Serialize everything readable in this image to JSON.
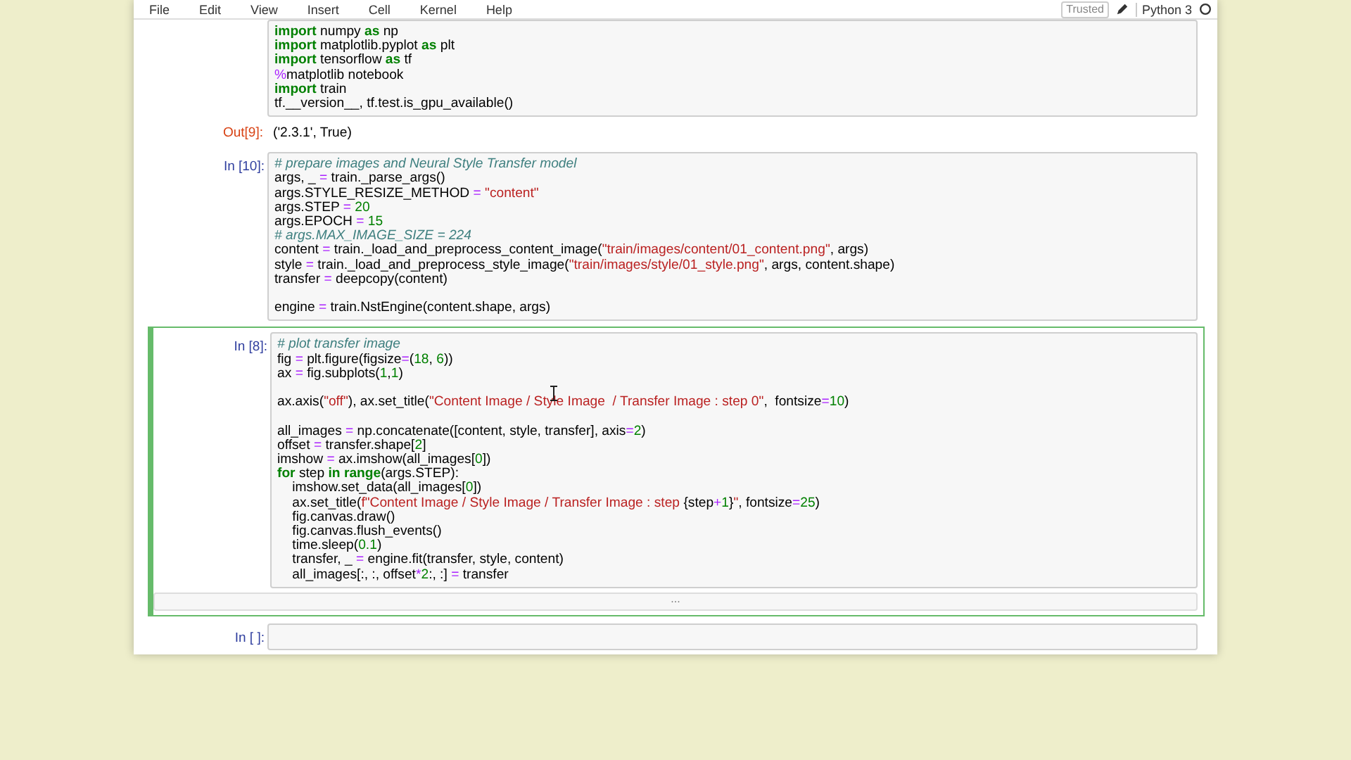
{
  "menu": [
    "File",
    "Edit",
    "View",
    "Insert",
    "Cell",
    "Kernel",
    "Help"
  ],
  "indicators": {
    "trusted": "Trusted",
    "kernel": "Python 3"
  },
  "cells": [
    {
      "kind": "code",
      "selected": false,
      "lines": [
        {
          "kind": "code",
          "tokens": [
            {
              "kind": "keyword",
              "text": "import"
            },
            {
              "kind": "plain",
              "text": " numpy "
            },
            {
              "kind": "keyword",
              "text": "as"
            },
            {
              "kind": "plain",
              "text": " np"
            }
          ]
        },
        {
          "kind": "code",
          "tokens": [
            {
              "kind": "keyword",
              "text": "import"
            },
            {
              "kind": "plain",
              "text": " matplotlib.pyplot "
            },
            {
              "kind": "keyword",
              "text": "as"
            },
            {
              "kind": "plain",
              "text": " plt"
            }
          ]
        },
        {
          "kind": "code",
          "tokens": [
            {
              "kind": "keyword",
              "text": "import"
            },
            {
              "kind": "plain",
              "text": " tensorflow "
            },
            {
              "kind": "keyword",
              "text": "as"
            },
            {
              "kind": "plain",
              "text": " tf"
            }
          ]
        },
        {
          "kind": "code",
          "tokens": [
            {
              "kind": "operator",
              "text": "%"
            },
            {
              "kind": "plain",
              "text": "matplotlib notebook"
            }
          ]
        },
        {
          "kind": "code",
          "tokens": [
            {
              "kind": "keyword",
              "text": "import"
            },
            {
              "kind": "plain",
              "text": " train"
            }
          ]
        },
        {
          "kind": "code",
          "tokens": [
            {
              "kind": "plain",
              "text": "tf.__version__, tf.test.is_gpu_available()"
            }
          ]
        }
      ]
    },
    {
      "kind": "output",
      "prompt": "Out[9]:",
      "text": "('2.3.1', True)"
    },
    {
      "kind": "code",
      "prompt": "In [10]:",
      "selected": false,
      "lines": [
        {
          "kind": "code",
          "tokens": [
            {
              "kind": "comment",
              "text": "# prepare images and Neural Style Transfer model"
            }
          ]
        },
        {
          "kind": "code",
          "tokens": [
            {
              "kind": "plain",
              "text": "args, _ "
            },
            {
              "kind": "operator",
              "text": "="
            },
            {
              "kind": "plain",
              "text": " train._parse_args()"
            }
          ]
        },
        {
          "kind": "code",
          "tokens": [
            {
              "kind": "plain",
              "text": "args.STYLE_RESIZE_METHOD "
            },
            {
              "kind": "operator",
              "text": "="
            },
            {
              "kind": "string",
              "text": " \"content\""
            }
          ]
        },
        {
          "kind": "code",
          "tokens": [
            {
              "kind": "plain",
              "text": "args.STEP "
            },
            {
              "kind": "operator",
              "text": "="
            },
            {
              "kind": "number",
              "text": " 20"
            }
          ]
        },
        {
          "kind": "code",
          "tokens": [
            {
              "kind": "plain",
              "text": "args.EPOCH "
            },
            {
              "kind": "operator",
              "text": "="
            },
            {
              "kind": "number",
              "text": " 15"
            }
          ]
        },
        {
          "kind": "code",
          "tokens": [
            {
              "kind": "comment",
              "text": "# args.MAX_IMAGE_SIZE = 224"
            }
          ]
        },
        {
          "kind": "code",
          "tokens": [
            {
              "kind": "plain",
              "text": "content "
            },
            {
              "kind": "operator",
              "text": "="
            },
            {
              "kind": "plain",
              "text": " train._load_and_preprocess_content_image("
            },
            {
              "kind": "string",
              "text": "\"train/images/content/01_content.png\""
            },
            {
              "kind": "plain",
              "text": ", args)"
            }
          ]
        },
        {
          "kind": "code",
          "tokens": [
            {
              "kind": "plain",
              "text": "style "
            },
            {
              "kind": "operator",
              "text": "="
            },
            {
              "kind": "plain",
              "text": " train._load_and_preprocess_style_image("
            },
            {
              "kind": "string",
              "text": "\"train/images/style/01_style.png\""
            },
            {
              "kind": "plain",
              "text": ", args, content.shape)"
            }
          ]
        },
        {
          "kind": "code",
          "tokens": [
            {
              "kind": "plain",
              "text": "transfer "
            },
            {
              "kind": "operator",
              "text": "="
            },
            {
              "kind": "plain",
              "text": " deepcopy(content)"
            }
          ]
        },
        {
          "kind": "blank"
        },
        {
          "kind": "code",
          "tokens": [
            {
              "kind": "plain",
              "text": "engine "
            },
            {
              "kind": "operator",
              "text": "="
            },
            {
              "kind": "plain",
              "text": " train.NstEngine(content.shape, args)"
            }
          ]
        }
      ]
    },
    {
      "kind": "code",
      "prompt": "In [8]:",
      "selected": true,
      "collapsed_output": "...",
      "lines": [
        {
          "kind": "code",
          "tokens": [
            {
              "kind": "comment",
              "text": "# plot transfer image"
            }
          ]
        },
        {
          "kind": "code",
          "tokens": [
            {
              "kind": "plain",
              "text": "fig "
            },
            {
              "kind": "operator",
              "text": "="
            },
            {
              "kind": "plain",
              "text": " plt.figure(figsize"
            },
            {
              "kind": "operator",
              "text": "="
            },
            {
              "kind": "plain",
              "text": "("
            },
            {
              "kind": "number",
              "text": "18"
            },
            {
              "kind": "plain",
              "text": ", "
            },
            {
              "kind": "number",
              "text": "6"
            },
            {
              "kind": "plain",
              "text": "))"
            }
          ]
        },
        {
          "kind": "code",
          "tokens": [
            {
              "kind": "plain",
              "text": "ax "
            },
            {
              "kind": "operator",
              "text": "="
            },
            {
              "kind": "plain",
              "text": " fig.subplots("
            },
            {
              "kind": "number",
              "text": "1"
            },
            {
              "kind": "plain",
              "text": ","
            },
            {
              "kind": "number",
              "text": "1"
            },
            {
              "kind": "plain",
              "text": ")"
            }
          ]
        },
        {
          "kind": "blank"
        },
        {
          "kind": "code",
          "tokens": [
            {
              "kind": "plain",
              "text": "ax.axis("
            },
            {
              "kind": "string",
              "text": "\"off\""
            },
            {
              "kind": "plain",
              "text": "), ax.set_title("
            },
            {
              "kind": "string",
              "text": "\"Content Image / Style Image  / Transfer Image : step 0\""
            },
            {
              "kind": "plain",
              "text": ",  fontsize"
            },
            {
              "kind": "operator",
              "text": "="
            },
            {
              "kind": "number",
              "text": "10"
            },
            {
              "kind": "plain",
              "text": ")"
            }
          ]
        },
        {
          "kind": "blank"
        },
        {
          "kind": "code",
          "tokens": [
            {
              "kind": "plain",
              "text": "all_images "
            },
            {
              "kind": "operator",
              "text": "="
            },
            {
              "kind": "plain",
              "text": " np.concatenate([content, style, transfer], axis"
            },
            {
              "kind": "operator",
              "text": "="
            },
            {
              "kind": "number",
              "text": "2"
            },
            {
              "kind": "plain",
              "text": ")"
            }
          ]
        },
        {
          "kind": "code",
          "tokens": [
            {
              "kind": "plain",
              "text": "offset "
            },
            {
              "kind": "operator",
              "text": "="
            },
            {
              "kind": "plain",
              "text": " transfer.shape["
            },
            {
              "kind": "number",
              "text": "2"
            },
            {
              "kind": "plain",
              "text": "]"
            }
          ]
        },
        {
          "kind": "code",
          "tokens": [
            {
              "kind": "plain",
              "text": "imshow "
            },
            {
              "kind": "operator",
              "text": "="
            },
            {
              "kind": "plain",
              "text": " ax.imshow(all_images["
            },
            {
              "kind": "number",
              "text": "0"
            },
            {
              "kind": "plain",
              "text": "])"
            }
          ]
        },
        {
          "kind": "code",
          "tokens": [
            {
              "kind": "keyword",
              "text": "for"
            },
            {
              "kind": "plain",
              "text": " step "
            },
            {
              "kind": "keyword",
              "text": "in range"
            },
            {
              "kind": "plain",
              "text": "(args.STEP):"
            }
          ]
        },
        {
          "kind": "code",
          "tokens": [
            {
              "kind": "plain",
              "text": "    imshow.set_data(all_images["
            },
            {
              "kind": "number",
              "text": "0"
            },
            {
              "kind": "plain",
              "text": "])"
            }
          ]
        },
        {
          "kind": "code",
          "tokens": [
            {
              "kind": "plain",
              "text": "    ax.set_title("
            },
            {
              "kind": "string",
              "text": "f\"Content Image / Style Image / Transfer Image : step "
            },
            {
              "kind": "plain",
              "text": "{step"
            },
            {
              "kind": "operator",
              "text": "+"
            },
            {
              "kind": "number",
              "text": "1"
            },
            {
              "kind": "plain",
              "text": "}"
            },
            {
              "kind": "string",
              "text": "\""
            },
            {
              "kind": "plain",
              "text": ", fontsize"
            },
            {
              "kind": "operator",
              "text": "="
            },
            {
              "kind": "number",
              "text": "25"
            },
            {
              "kind": "plain",
              "text": ")"
            }
          ]
        },
        {
          "kind": "code",
          "tokens": [
            {
              "kind": "plain",
              "text": "    fig.canvas.draw()"
            }
          ]
        },
        {
          "kind": "code",
          "tokens": [
            {
              "kind": "plain",
              "text": "    fig.canvas.flush_events()"
            }
          ]
        },
        {
          "kind": "code",
          "tokens": [
            {
              "kind": "plain",
              "text": "    time.sleep("
            },
            {
              "kind": "number",
              "text": "0.1"
            },
            {
              "kind": "plain",
              "text": ")"
            }
          ]
        },
        {
          "kind": "code",
          "tokens": [
            {
              "kind": "plain",
              "text": "    transfer, _ "
            },
            {
              "kind": "operator",
              "text": "="
            },
            {
              "kind": "plain",
              "text": " engine.fit(transfer, style, content)"
            }
          ]
        },
        {
          "kind": "code",
          "tokens": [
            {
              "kind": "plain",
              "text": "    all_images[:, :, offset"
            },
            {
              "kind": "operator",
              "text": "*"
            },
            {
              "kind": "number",
              "text": "2"
            },
            {
              "kind": "plain",
              "text": ":, :] "
            },
            {
              "kind": "operator",
              "text": "="
            },
            {
              "kind": "plain",
              "text": " transfer"
            }
          ]
        }
      ]
    },
    {
      "kind": "code",
      "prompt": "In [ ]:",
      "selected": false
    }
  ]
}
